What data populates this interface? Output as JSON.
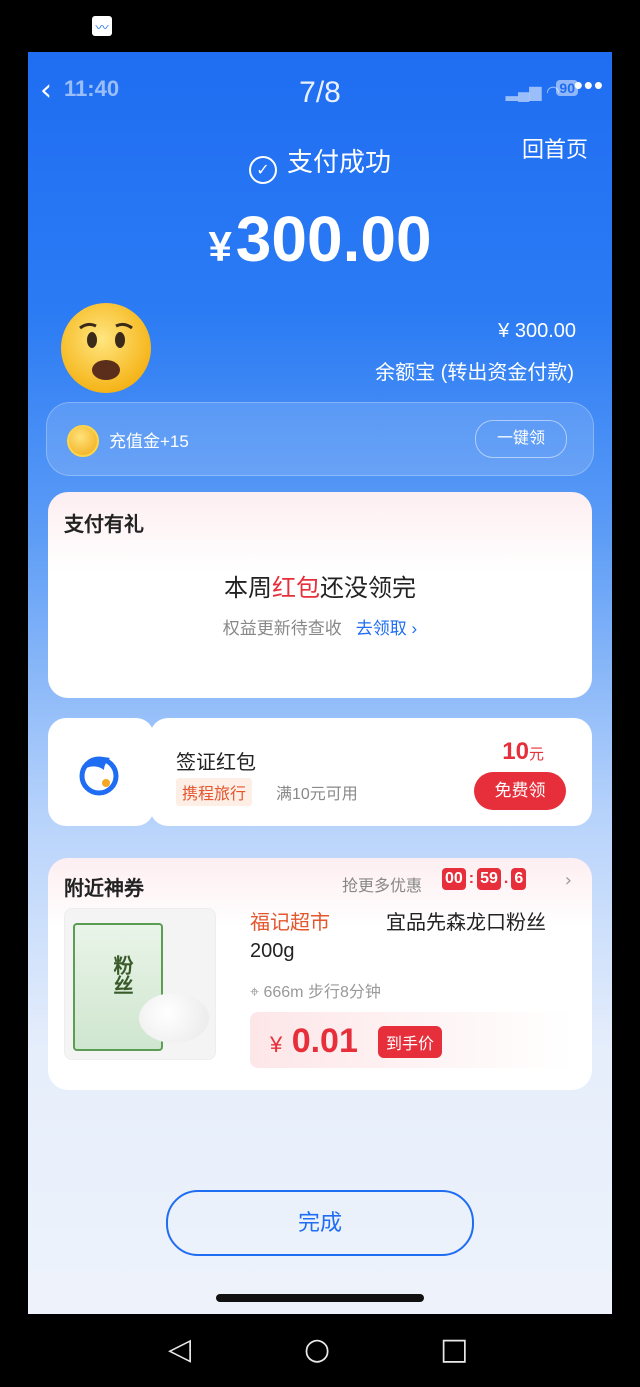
{
  "status_bar": {
    "time": "11:40",
    "page_indicator": "7/8",
    "battery": "90"
  },
  "header": {
    "back_icon": "back-chevron-icon",
    "more_icon": "more-icon",
    "home_link": "回首页"
  },
  "payment": {
    "success_text": "支付成功",
    "currency": "¥",
    "amount": "300.00",
    "paid_amount": "¥ 300.00",
    "paid_source": "余额宝 (转出资金付款)"
  },
  "bonus": {
    "text": "充值金+15",
    "button": "一键领"
  },
  "gift_card": {
    "title": "支付有礼",
    "headline_prefix": "本周",
    "headline_highlight": "红包",
    "headline_suffix": "还没领完",
    "subtitle": "权益更新待查收",
    "link": "去领取 ›"
  },
  "visa_card": {
    "title": "签证红包",
    "brand_tag": "携程旅行",
    "condition": "满10元可用",
    "value": "10",
    "unit": "元",
    "button": "免费领"
  },
  "nearby": {
    "title": "附近神券",
    "more_text": "抢更多优惠",
    "timer": {
      "h": "00",
      "m": "59",
      "s": "6"
    },
    "product": {
      "store": "福记超市",
      "name": "宜品先森龙口粉丝",
      "weight": "200g",
      "distance": "666m 步行8分钟",
      "currency": "¥",
      "price": "0.01",
      "price_tag": "到手价",
      "image_label": "粉丝"
    }
  },
  "done_button": "完成",
  "colors": {
    "brand_blue": "#1f6df2",
    "accent_red": "#e62f3a",
    "store_orange": "#e3562e"
  }
}
